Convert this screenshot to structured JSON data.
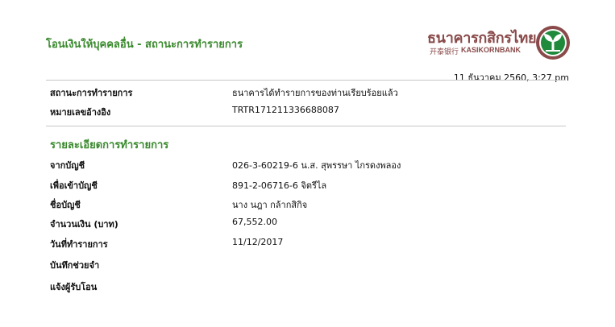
{
  "header": {
    "title": "โอนเงินให้บุคคลอื่น - สถานะการทำรายการ",
    "timestamp": "11 ธันวาคม 2560, 3:27 pm"
  },
  "logo": {
    "name_th": "ธนาคารกสิกรไทย",
    "name_cn": "开泰银行",
    "name_en": "KASIKORNBANK",
    "brand_color": "#8a4a4a",
    "emblem_color": "#1f8a3c"
  },
  "status_section": {
    "rows": [
      {
        "label": "สถานะการทำรายการ",
        "value": "ธนาคารได้ทำรายการของท่านเรียบร้อยแล้ว"
      },
      {
        "label": "หมายเลขอ้างอิง",
        "value": "TRTR171211336688087"
      }
    ]
  },
  "details_section": {
    "title": "รายละเอียดการทำรายการ",
    "rows": [
      {
        "label": "จากบัญชี",
        "value": "026-3-60219-6 น.ส. สุพรรษา ไกรดงพลอง"
      },
      {
        "label": "เพื่อเข้าบัญชี",
        "value": "891-2-06716-6 จิตรีไล"
      },
      {
        "label": "ชื่อบัญชี",
        "value": "นาง นฎา กล้ากสิกิจ"
      },
      {
        "label": "จำนวนเงิน (บาท)",
        "value": "67,552.00"
      },
      {
        "label": "วันที่ทำรายการ",
        "value": "11/12/2017"
      },
      {
        "label": "บันทึกช่วยจำ",
        "value": ""
      },
      {
        "label": "แจ้งผู้รับโอน",
        "value": ""
      }
    ]
  },
  "colors": {
    "accent_green": "#3a8a2e",
    "divider": "#c6c6c6"
  }
}
